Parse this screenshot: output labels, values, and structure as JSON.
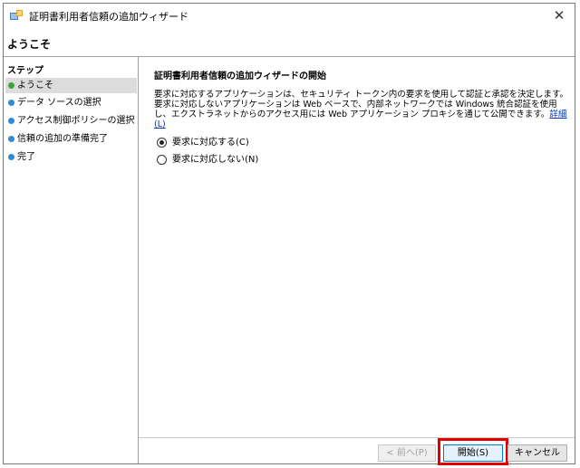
{
  "window": {
    "title": "証明書利用者信頼の追加ウィザード",
    "close_glyph": "✕"
  },
  "header": {
    "title": "ようこそ"
  },
  "sidebar": {
    "heading": "ステップ",
    "items": [
      {
        "label": "ようこそ",
        "active": true
      },
      {
        "label": "データ ソースの選択",
        "active": false
      },
      {
        "label": "アクセス制御ポリシーの選択",
        "active": false
      },
      {
        "label": "信頼の追加の準備完了",
        "active": false
      },
      {
        "label": "完了",
        "active": false
      }
    ],
    "dot_color": "#2e8bd8",
    "active_dot_color": "#3aa63a"
  },
  "main": {
    "heading": "証明書利用者信頼の追加ウィザードの開始",
    "description": "要求に対応するアプリケーションは、セキュリティ トークン内の要求を使用して認証と承認を決定します。要求に対応しないアプリケーションは Web ベースで、内部ネットワークでは Windows 統合認証を使用し、エクストラネットからのアクセス用には Web アプリケーション プロキシを通じて公開できます。",
    "more_link": "詳細(L)",
    "options": [
      {
        "label": "要求に対応する(C)",
        "checked": true
      },
      {
        "label": "要求に対応しない(N)",
        "checked": false
      }
    ]
  },
  "footer": {
    "back_label": "< 前へ(P)",
    "start_label": "開始(S)",
    "cancel_label": "キャンセル",
    "highlight_color": "#e00000"
  }
}
